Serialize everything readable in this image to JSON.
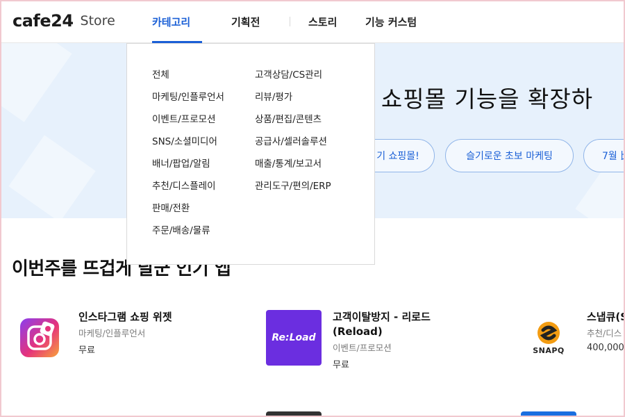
{
  "header": {
    "logo_text": "cafe24",
    "logo_store": "Store",
    "nav": [
      "카테고리",
      "기획전",
      "스토리",
      "기능 커스텀"
    ]
  },
  "dropdown": {
    "col1": [
      "전체",
      "마케팅/인플루언서",
      "이벤트/프로모션",
      "SNS/소셜미디어",
      "배너/팝업/알림",
      "추천/디스플레이",
      "판매/전환",
      "주문/배송/물류"
    ],
    "col2": [
      "고객상담/CS관리",
      "리뷰/평가",
      "상품/편집/콘텐츠",
      "공급사/셀러솔루션",
      "매출/통계/보고서",
      "관리도구/편의/ERP"
    ]
  },
  "hero": {
    "title": "로 쇼핑몰 기능을 확장하",
    "pills": [
      "기 쇼핑몰!",
      "슬기로운 초보 마케팅",
      "7월 比"
    ]
  },
  "section": {
    "title": "이번주를 뜨겁게 달군 인기 앱"
  },
  "apps": [
    {
      "name": "인스타그램 쇼핑 위젯",
      "category": "마케팅/인플루언서",
      "price": "무료",
      "icon": "instagram-pin-icon"
    },
    {
      "name": "고객이탈방지 - 리로드 (Reload)",
      "name_line1": "고객이탈방지 - 리로드",
      "name_line2": "(Reload)",
      "category": "이벤트/프로모션",
      "price": "무료",
      "icon_text": "Re:Load"
    },
    {
      "name": "스냅큐(S",
      "category": "추천/디스",
      "price": "400,000",
      "icon_text": "SNAPQ"
    }
  ],
  "colors": {
    "accent": "#1a5fd6",
    "hero_bg": "#e7f1fc",
    "reload_purple": "#6b2ee0",
    "snapq_orange": "#f39c12"
  }
}
